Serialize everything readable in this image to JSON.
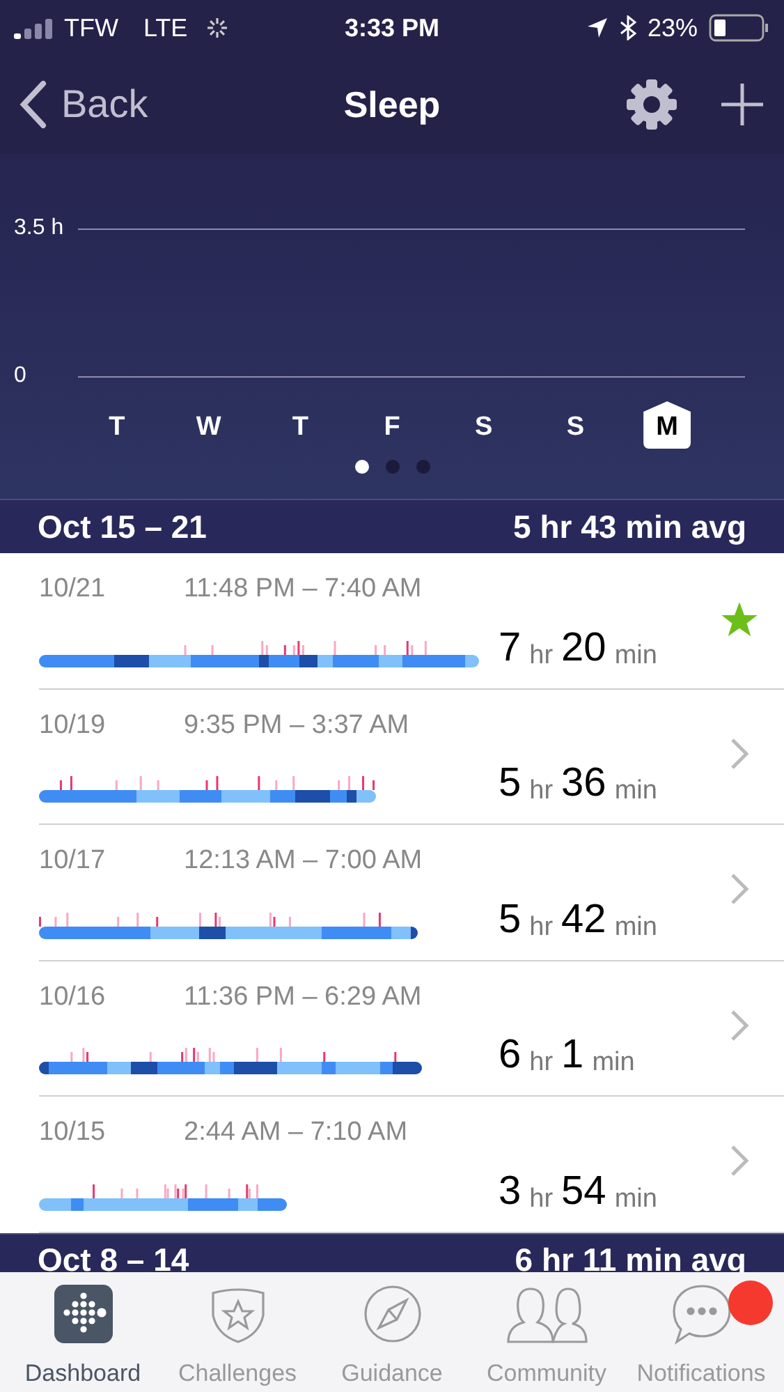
{
  "status_bar": {
    "carrier": "TFW",
    "network": "LTE",
    "time": "3:33 PM",
    "battery": "23%"
  },
  "nav": {
    "back": "Back",
    "title": "Sleep"
  },
  "chart": {
    "y_labels": [
      "3.5 h",
      "0"
    ],
    "days": [
      {
        "label": "T",
        "selected": false
      },
      {
        "label": "W",
        "selected": false
      },
      {
        "label": "T",
        "selected": false
      },
      {
        "label": "F",
        "selected": false
      },
      {
        "label": "S",
        "selected": false
      },
      {
        "label": "S",
        "selected": false
      },
      {
        "label": "M",
        "selected": true
      }
    ],
    "pages": [
      {
        "selected": true
      },
      {
        "selected": false
      },
      {
        "selected": false
      }
    ]
  },
  "weeks": [
    {
      "range": "Oct 15 – 21",
      "average": "5 hr 43 min avg",
      "nights": [
        {
          "date": "10/21",
          "time": "11:48 PM – 7:40 AM",
          "hours": "7",
          "hr": "hr",
          "minutes": "20",
          "min": "min",
          "kind": "star"
        },
        {
          "date": "10/19",
          "time": "9:35 PM – 3:37 AM",
          "hours": "5",
          "hr": "hr",
          "minutes": "36",
          "min": "min",
          "kind": "chevron"
        },
        {
          "date": "10/17",
          "time": "12:13 AM – 7:00 AM",
          "hours": "5",
          "hr": "hr",
          "minutes": "42",
          "min": "min",
          "kind": "chevron"
        },
        {
          "date": "10/16",
          "time": "11:36 PM – 6:29 AM",
          "hours": "6",
          "hr": "hr",
          "minutes": "1",
          "min": "min",
          "kind": "chevron"
        },
        {
          "date": "10/15",
          "time": "2:44 AM – 7:10 AM",
          "hours": "3",
          "hr": "hr",
          "minutes": "54",
          "min": "min",
          "kind": "chevron"
        }
      ]
    },
    {
      "range": "Oct 8 – 14",
      "average": "6 hr 11 min avg"
    }
  ],
  "tabs": [
    {
      "label": "Dashboard",
      "selected": true,
      "badge": false
    },
    {
      "label": "Challenges",
      "selected": false,
      "badge": false
    },
    {
      "label": "Guidance",
      "selected": false,
      "badge": false
    },
    {
      "label": "Community",
      "selected": false,
      "badge": false
    },
    {
      "label": "Notifications",
      "selected": false,
      "badge": true
    }
  ]
}
